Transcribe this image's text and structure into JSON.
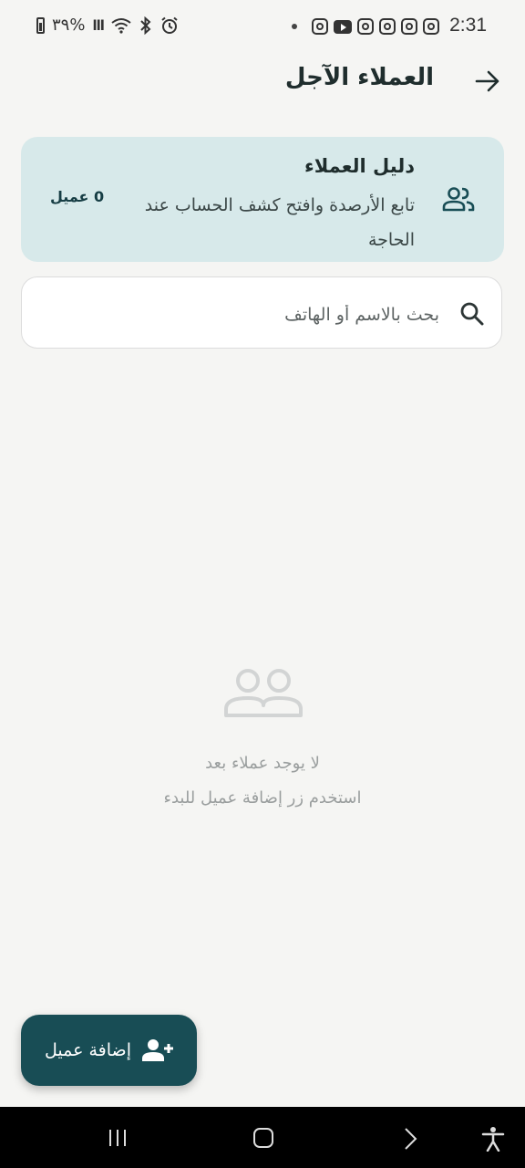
{
  "status_bar": {
    "time": "2:31",
    "battery": "٣٩%",
    "signal_glyph": "lll"
  },
  "header": {
    "title": "العملاء الآجل",
    "back_icon": "arrow-back-icon"
  },
  "directory_card": {
    "title": "دليل العملاء",
    "subtitle": "تابع الأرصدة وافتح كشف الحساب عند الحاجة",
    "count": "0 عميل",
    "icon": "people-icon"
  },
  "search": {
    "placeholder": "بحث بالاسم أو الهاتف",
    "value": "",
    "icon": "search-icon"
  },
  "empty_state": {
    "title": "لا يوجد عملاء بعد",
    "subtitle": "استخدم زر إضافة عميل للبدء",
    "icon": "people-outline-icon"
  },
  "fab": {
    "label": "إضافة عميل",
    "icon": "person-add-icon"
  },
  "colors": {
    "background": "#f5f5f3",
    "card": "#d7e9ea",
    "accent": "#184d55",
    "muted_text": "#9a9e9e"
  }
}
